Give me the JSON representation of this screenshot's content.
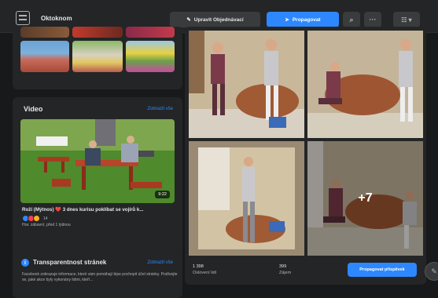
{
  "header": {
    "title": "Oktoknom",
    "edit_label": "Upravit Objednávací",
    "share_label": "Propagovat"
  },
  "icons": {
    "logo": "page-logo-icon",
    "edit": "pencil-icon",
    "share": "megaphone-icon",
    "search": "search-icon",
    "more": "more-icon",
    "page": "page-switch-icon"
  },
  "video_card": {
    "heading": "Video",
    "see_all": "Zobrazit vše",
    "duration": "9:22",
    "title": "Roží (Mýtnos) ❤️ 3 dnes kurisu poklíbat se vojírů k...",
    "reaction_count": "14",
    "meta": "Hra: zábavní, před 1 týdnou"
  },
  "transparency_card": {
    "heading": "Transparentnost stránek",
    "see_all": "Zobrazit vše",
    "text": "Facebook zobrazuje informace, které vám pomáhají lépe pochopit účel stránky. Podívejte se, jaké akce byly vykonány lidmi, kteří..."
  },
  "gallery": {
    "more_count": "+7",
    "stat1_value": "1 398",
    "stat1_label": "Oslovení lidí",
    "stat2_value": "399",
    "stat2_label": "Zájem",
    "view_button": "Propagovat příspěvek"
  },
  "colors": {
    "accent": "#2d88ff",
    "background": "#18191a",
    "card": "#242526",
    "button": "#3a3b3c"
  }
}
